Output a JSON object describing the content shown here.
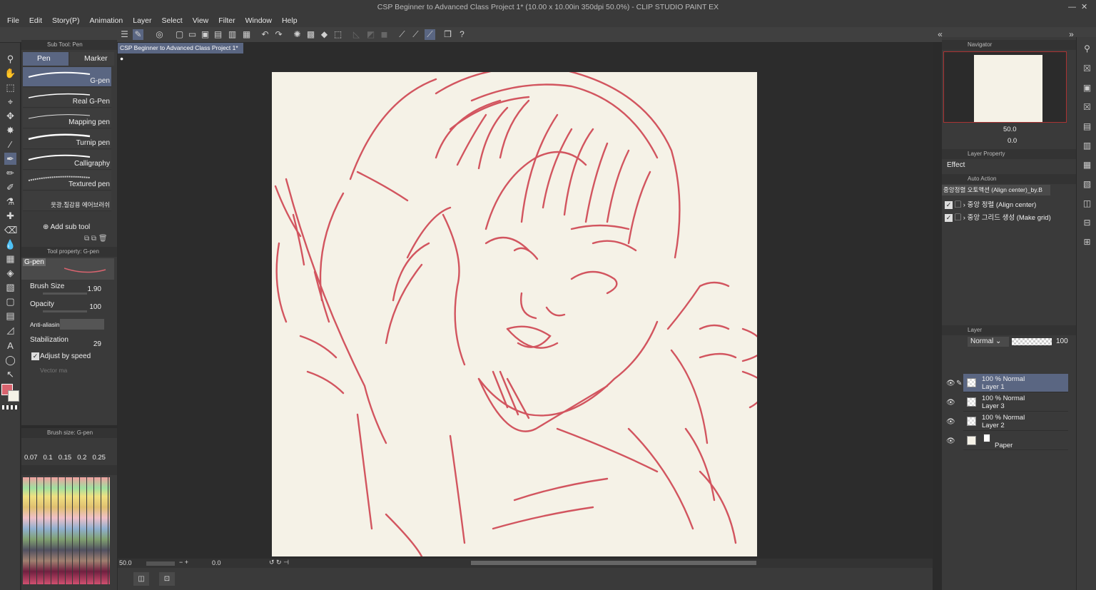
{
  "window": {
    "title": "CSP Beginner to Advanced Class Project 1* (10.00 x 10.00in 350dpi 50.0%)  - CLIP STUDIO PAINT EX"
  },
  "menu": [
    "File",
    "Edit",
    "Story(P)",
    "Animation",
    "Layer",
    "Select",
    "View",
    "Filter",
    "Window",
    "Help"
  ],
  "subtool": {
    "header": "Sub Tool: Pen",
    "tabs": [
      "Pen",
      "Marker"
    ],
    "brushes": [
      "G-pen",
      "Real G-Pen",
      "Mapping pen",
      "Turnip pen",
      "Calligraphy",
      "Textured pen",
      "웃광,질감용 에어브러쉬"
    ],
    "add_label": "Add sub tool"
  },
  "toolprop": {
    "header": "Tool property: G-pen",
    "preview_label": "G-pen",
    "brush_size_label": "Brush Size",
    "brush_size": "1.90",
    "opacity_label": "Opacity",
    "opacity": "100",
    "antialias_label": "Anti-aliasing",
    "stabilization_label": "Stabilization",
    "stabilization": "29",
    "adjust_label": "Adjust by speed",
    "vector_label": "Vector ma"
  },
  "brushsize": {
    "header": "Brush size: G-pen",
    "sizes": [
      "0.07",
      "0.1",
      "0.15",
      "0.2",
      "0.25"
    ]
  },
  "document": {
    "tab": "CSP Beginner to Advanced Class Project 1*"
  },
  "status": {
    "zoom": "50.0",
    "angle": "0.0"
  },
  "navigator": {
    "header": "Navigator",
    "zoom": "50.0",
    "angle": "0.0"
  },
  "layerprop": {
    "header": "Layer Property",
    "effect": "Effect"
  },
  "autoaction": {
    "header": "Auto Action",
    "set": "중앙정렬 오토액션 (Align center)_by.B",
    "items": [
      "중앙 정렬 (Align center)",
      "중앙 그리드 생성 (Make grid)"
    ]
  },
  "layers": {
    "header": "Layer",
    "blend": "Normal",
    "opacity": "100",
    "list": [
      {
        "mode": "100 % Normal",
        "name": "Layer 1"
      },
      {
        "mode": "100 % Normal",
        "name": "Layer 3"
      },
      {
        "mode": "100 % Normal",
        "name": "Layer 2"
      },
      {
        "mode": "",
        "name": "Paper"
      }
    ]
  },
  "colors": {
    "accent": "#5a6682",
    "stroke": "#d2555f",
    "paper": "#f5f2e7",
    "main_color": "#d9646f"
  }
}
